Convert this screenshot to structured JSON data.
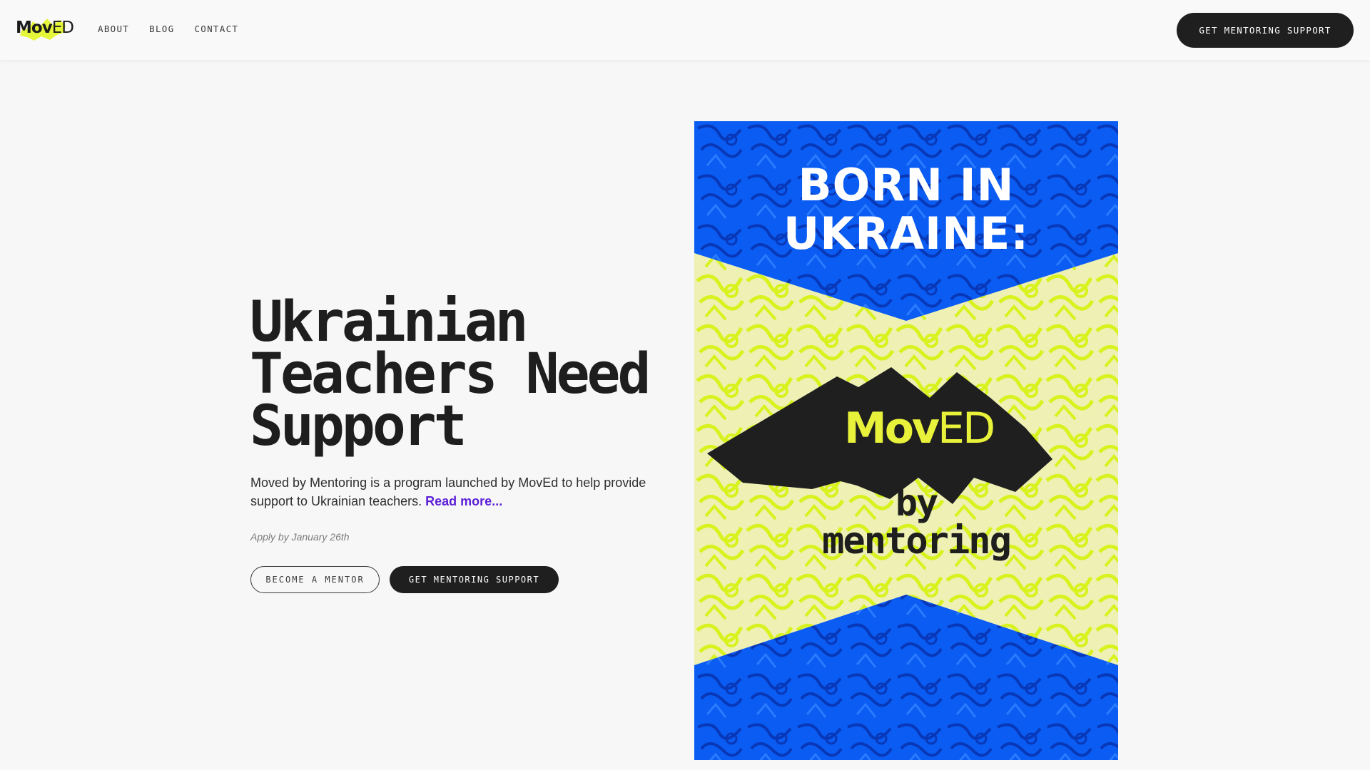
{
  "header": {
    "logo": {
      "bold": "Mov",
      "regular": "ED"
    },
    "nav": [
      {
        "label": "ABOUT"
      },
      {
        "label": "BLOG"
      },
      {
        "label": "CONTACT"
      }
    ],
    "cta_label": "GET MENTORING SUPPORT"
  },
  "hero": {
    "title": "Ukrainian Teachers Need Support",
    "description": "Moved by Mentoring is a program launched by MovEd to help provide support to Ukrainian teachers.",
    "read_more": "Read more...",
    "apply_note": "Apply by January 26th",
    "become_mentor_label": "BECOME A MENTOR",
    "get_support_label": "GET MENTORING SUPPORT"
  },
  "poster": {
    "headline": "BORN IN\nUKRAINE:",
    "brand": {
      "bold": "Mov",
      "regular": "ED"
    },
    "tagline": "by\nmentoring"
  },
  "colors": {
    "blue": "#0a5cf2",
    "yellow": "#e4f53a",
    "dark": "#1f1f1f",
    "link": "#5b1ed8",
    "background": "#f7f7f7"
  },
  "icons": {
    "logo_splash": "yellow-splash-icon",
    "poster_shape": "dark-angular-shape-icon"
  }
}
